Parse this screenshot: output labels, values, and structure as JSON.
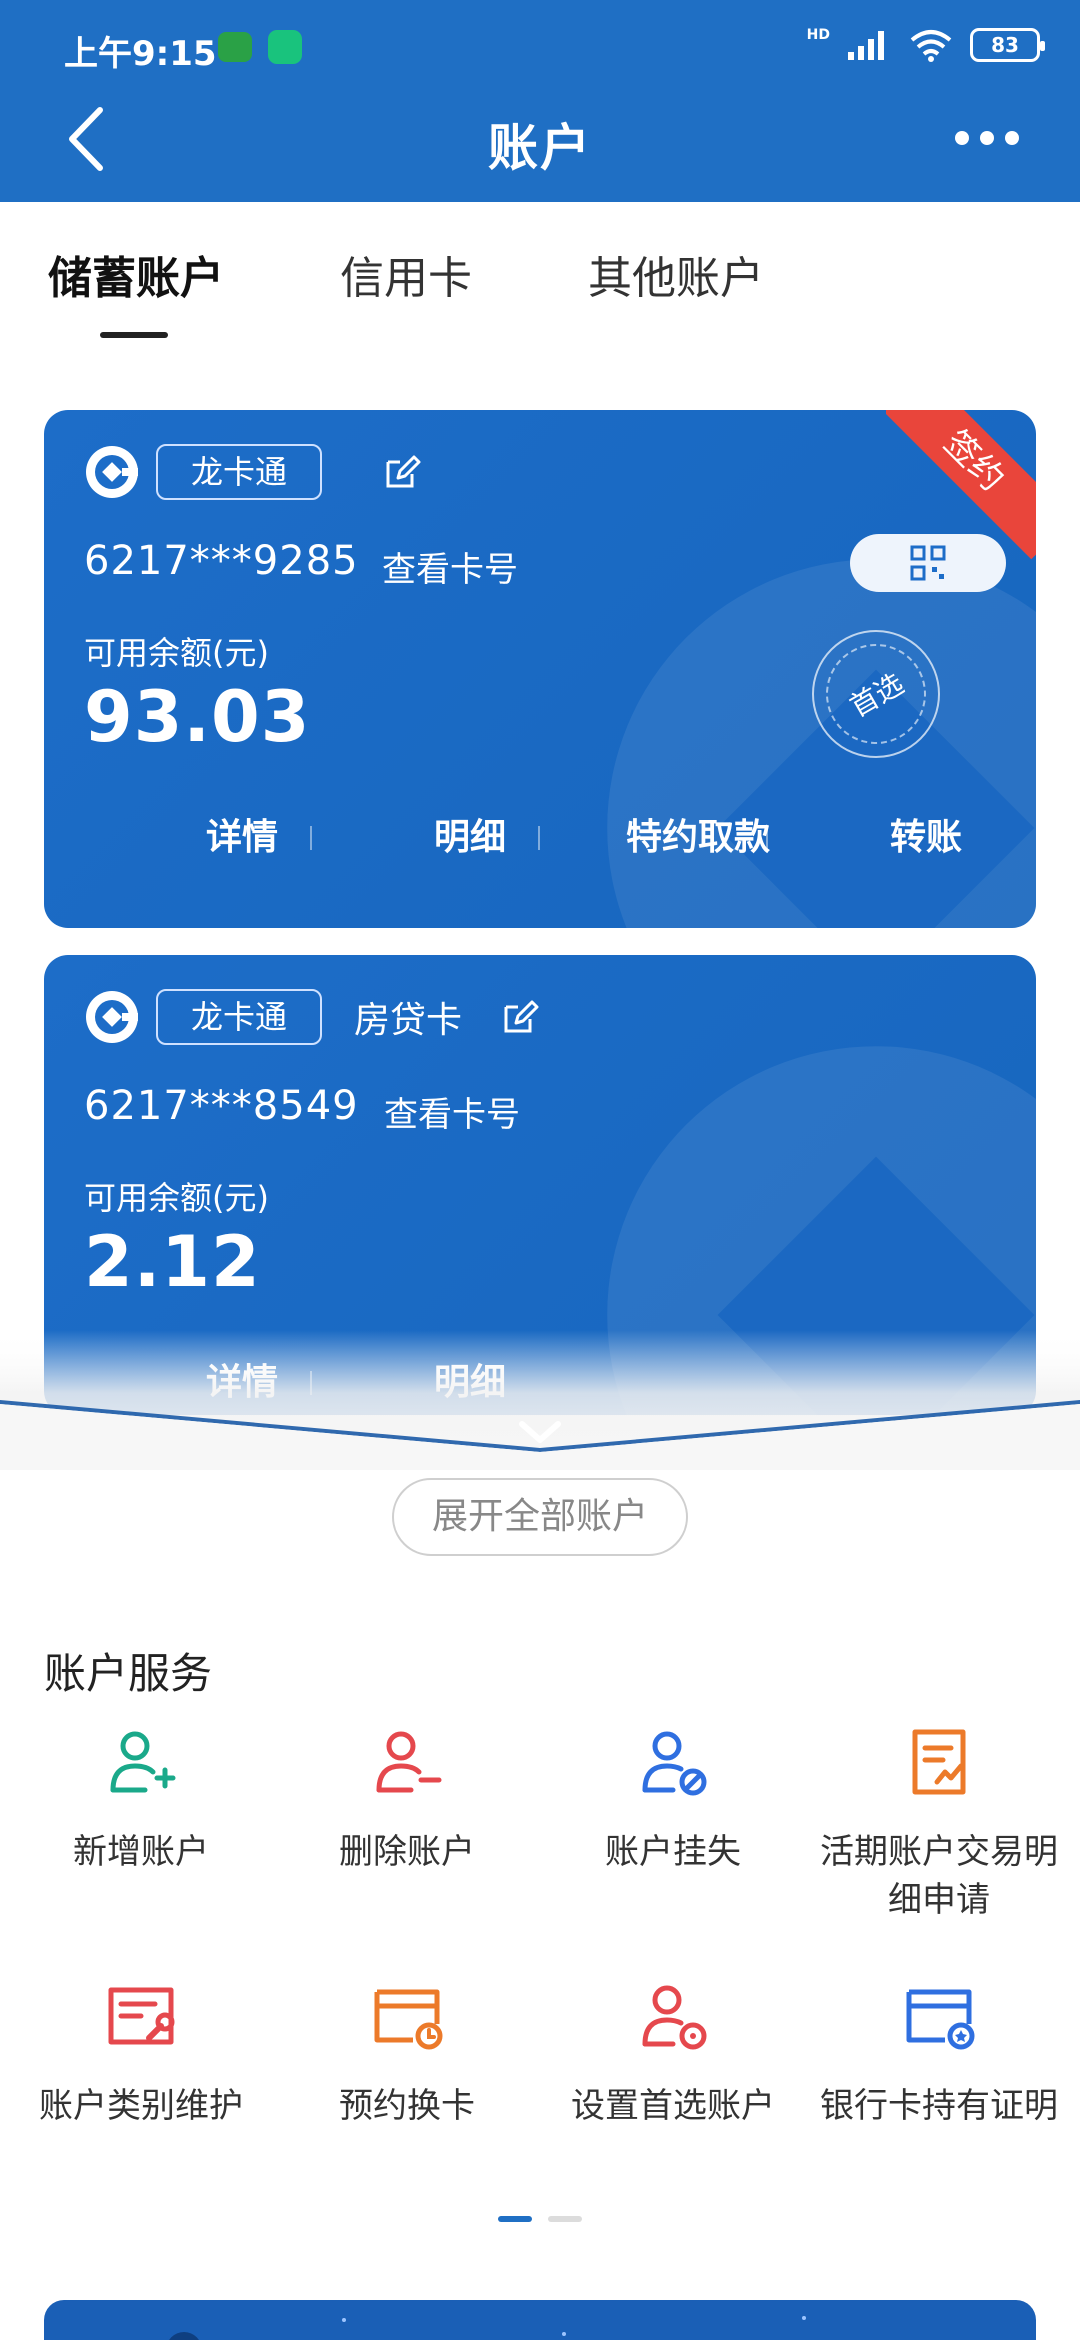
{
  "status_bar": {
    "time": "上午9:15",
    "network": "HD",
    "battery": "83"
  },
  "nav": {
    "title": "账户"
  },
  "tabs": [
    {
      "label": "储蓄账户",
      "active": true
    },
    {
      "label": "信用卡",
      "active": false
    },
    {
      "label": "其他账户",
      "active": false
    }
  ],
  "cards": [
    {
      "brand": "龙卡通",
      "subtag": "",
      "number": "6217***9285",
      "view_number": "查看卡号",
      "balance_label": "可用余额(元)",
      "balance": "93.03",
      "ribbon": "签约",
      "preferred_stamp": "首选",
      "actions": [
        "详情",
        "明细",
        "特约取款",
        "转账"
      ]
    },
    {
      "brand": "龙卡通",
      "subtag": "房贷卡",
      "number": "6217***8549",
      "view_number": "查看卡号",
      "balance_label": "可用余额(元)",
      "balance": "2.12",
      "actions": [
        "详情",
        "明细"
      ]
    }
  ],
  "expand_label": "展开全部账户",
  "services": {
    "title": "账户服务",
    "items": [
      {
        "label": "新增账户",
        "icon": "user-add-icon",
        "color": "#1aa98a"
      },
      {
        "label": "删除账户",
        "icon": "user-remove-icon",
        "color": "#e5484d"
      },
      {
        "label": "账户挂失",
        "icon": "user-block-icon",
        "color": "#2f6fe0"
      },
      {
        "label": "活期账户交易明细申请",
        "icon": "document-chart-icon",
        "color": "#ec7a2a"
      },
      {
        "label": "账户类别维护",
        "icon": "document-wrench-icon",
        "color": "#e5484d"
      },
      {
        "label": "预约换卡",
        "icon": "card-clock-icon",
        "color": "#ec7a2a"
      },
      {
        "label": "设置首选账户",
        "icon": "user-settings-icon",
        "color": "#e5484d"
      },
      {
        "label": "银行卡持有证明",
        "icon": "card-badge-icon",
        "color": "#2f6fe0"
      }
    ]
  },
  "colors": {
    "primary": "#1f6fc4",
    "ribbon": "#e9453b"
  }
}
